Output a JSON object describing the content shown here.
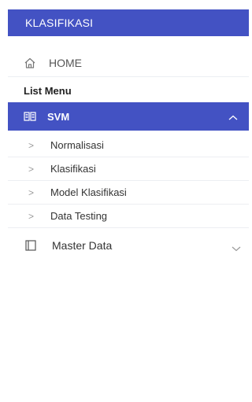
{
  "app": {
    "title": "KLASIFIKASI"
  },
  "nav": {
    "home_label": "HOME",
    "section_title": "List Menu",
    "active_item": {
      "label": "SVM",
      "expanded": true
    },
    "sub_items": [
      {
        "label": "Normalisasi"
      },
      {
        "label": "Klasifikasi"
      },
      {
        "label": "Model Klasifikasi"
      },
      {
        "label": "Data Testing"
      }
    ],
    "master_data": {
      "label": "Master Data",
      "expanded": false
    }
  },
  "colors": {
    "accent": "#4352c3",
    "divider": "#eceef2"
  },
  "icons": {
    "home": "home-icon",
    "svm": "book-icon",
    "master": "window-icon",
    "expand": "chevron-up-icon",
    "collapse": "chevron-down-icon",
    "sub_caret": "caret-right-icon"
  }
}
